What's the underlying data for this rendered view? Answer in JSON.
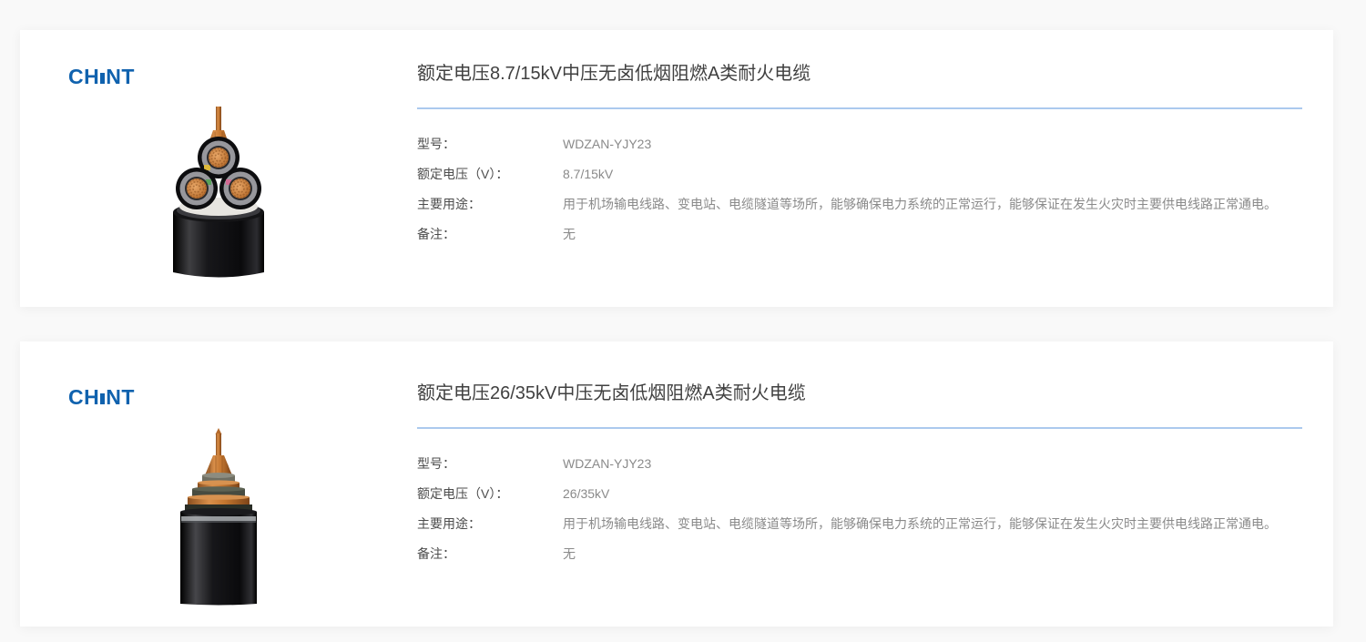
{
  "brand": {
    "logo_prefix": "CH",
    "logo_suffix": "NT",
    "logo_blue": "#1062ae",
    "logo_dot_red": "#e60012"
  },
  "theme": {
    "page_background": "#f9f9f9",
    "card_background": "#ffffff",
    "divider_blue": "#abc9ee",
    "title_color": "#404040",
    "label_color": "#4d4d4d",
    "value_color": "#8a8a8a"
  },
  "products": [
    {
      "title": "额定电压8.7/15kV中压无卤低烟阻燃A类耐火电缆",
      "image": "three-core-cable",
      "specs": [
        {
          "label": "型号：",
          "value": "WDZAN-YJY23"
        },
        {
          "label": "额定电压（V）：",
          "value": "8.7/15kV"
        },
        {
          "label": "主要用途：",
          "value": "用于机场输电线路、变电站、电缆隧道等场所，能够确保电力系统的正常运行，能够保证在发生火灾时主要供电线路正常通电。"
        },
        {
          "label": "备注：",
          "value": "无"
        }
      ]
    },
    {
      "title": "额定电压26/35kV中压无卤低烟阻燃A类耐火电缆",
      "image": "single-core-cable",
      "specs": [
        {
          "label": "型号：",
          "value": "WDZAN-YJY23"
        },
        {
          "label": "额定电压（V）：",
          "value": "26/35kV"
        },
        {
          "label": "主要用途：",
          "value": "用于机场输电线路、变电站、电缆隧道等场所，能够确保电力系统的正常运行，能够保证在发生火灾时主要供电线路正常通电。"
        },
        {
          "label": "备注：",
          "value": "无"
        }
      ]
    }
  ]
}
